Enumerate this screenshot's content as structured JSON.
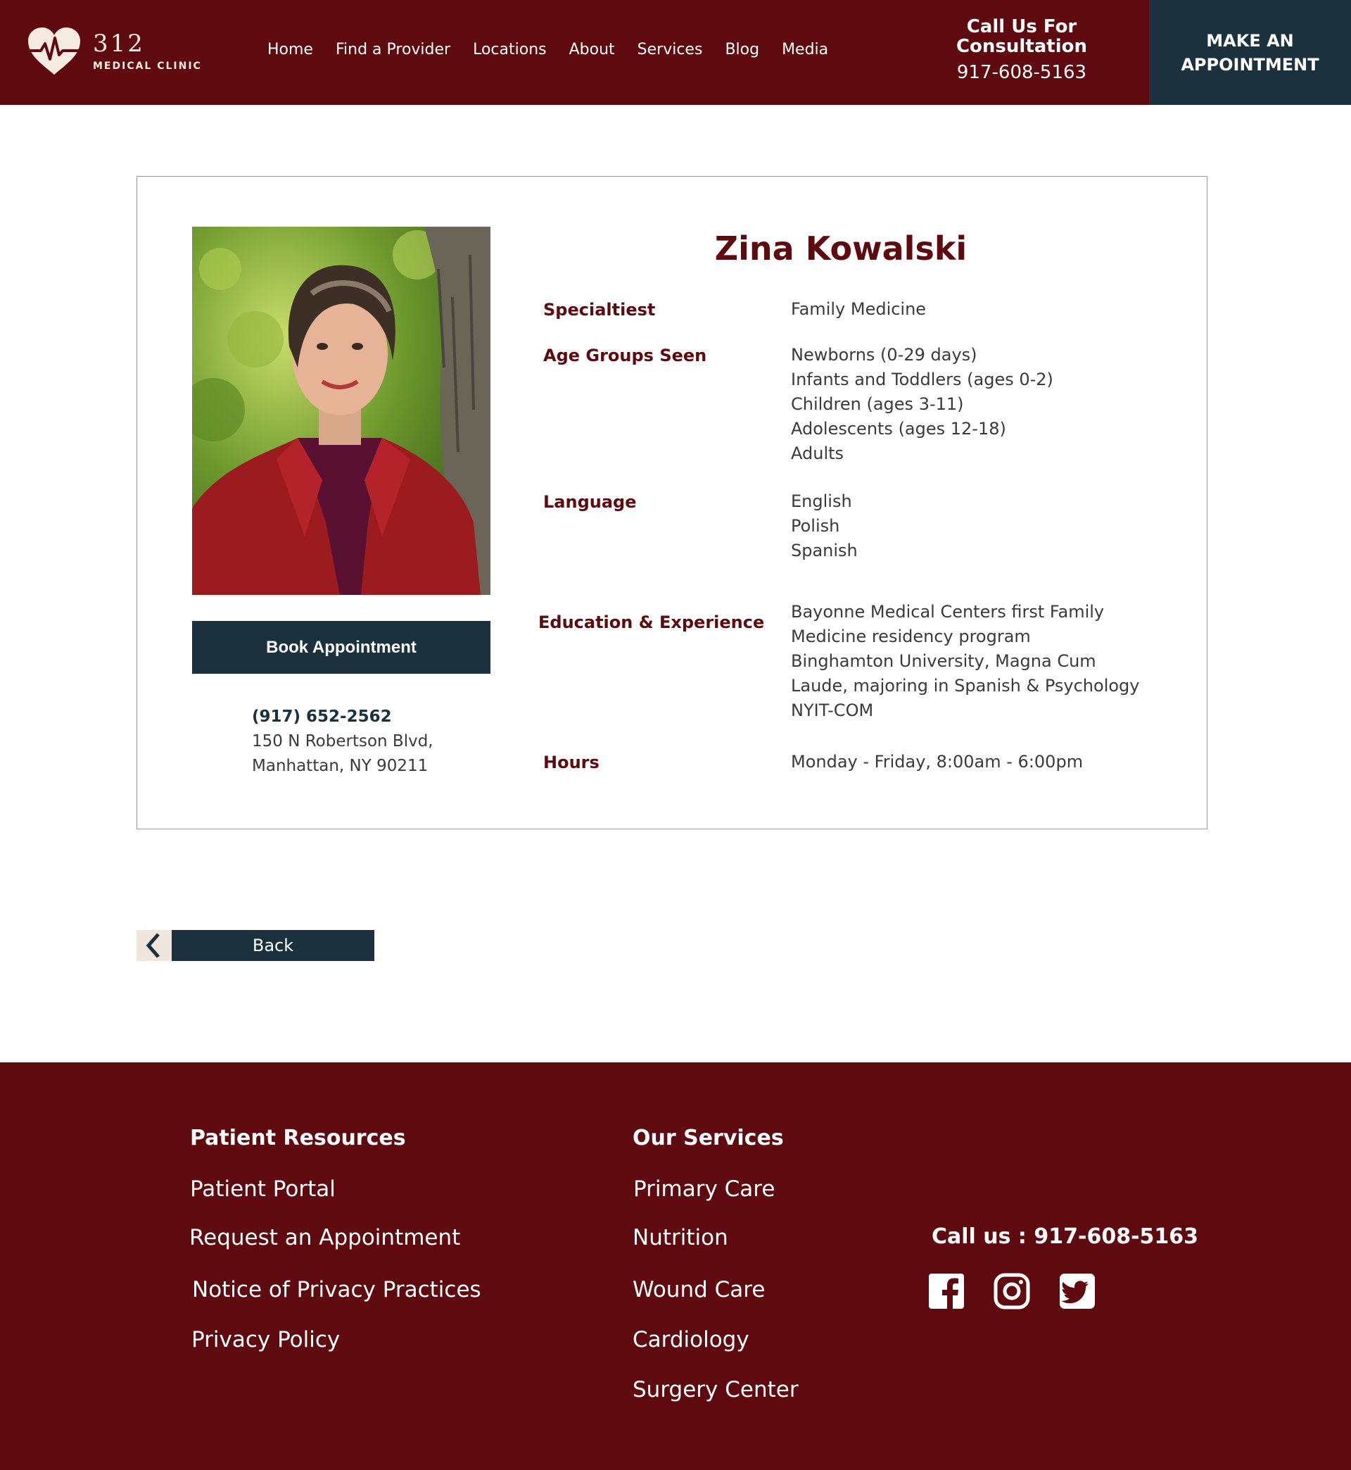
{
  "header": {
    "logo_number": "312",
    "logo_sub": "MEDICAL CLINIC",
    "nav": [
      "Home",
      "Find a Provider",
      "Locations",
      "About",
      "Services",
      "Blog",
      "Media"
    ],
    "call_title_1": "Call Us For",
    "call_title_2": "Consultation",
    "call_phone": "917-608-5163",
    "appointment_1": "MAKE AN",
    "appointment_2": "APPOINTMENT"
  },
  "provider": {
    "name": "Zina Kowalski",
    "book_label": "Book Appointment",
    "phone": "(917) 652-2562",
    "address_1": "150 N Robertson Blvd,",
    "address_2": "Manhattan, NY 90211",
    "labels": {
      "specialty": "Specialtiest",
      "age_groups": "Age Groups Seen",
      "language": "Language",
      "education": "Education & Experience",
      "hours": "Hours"
    },
    "specialty": "Family Medicine",
    "age_groups": [
      "Newborns (0-29 days)",
      "Infants and Toddlers (ages 0-2)",
      "Children (ages 3-11)",
      "Adolescents (ages 12-18)",
      "Adults"
    ],
    "languages": [
      "English",
      "Polish",
      "Spanish"
    ],
    "education": [
      "Bayonne Medical Centers first Family",
      "Medicine residency program",
      "Binghamton University, Magna Cum",
      "Laude, majoring in Spanish & Psychology",
      "NYIT-COM"
    ],
    "hours": "Monday - Friday,  8:00am - 6:00pm"
  },
  "back_label": "Back",
  "footer": {
    "patient_resources_title": "Patient Resources",
    "patient_resources": [
      "Patient Portal",
      "Request an Appointment",
      "Notice of Privacy Practices",
      "Privacy Policy"
    ],
    "services_title": "Our Services",
    "services": [
      "Primary Care",
      "Nutrition",
      "Wound Care",
      "Cardiology",
      "Surgery Center"
    ],
    "call": "Call us : 917-608-5163"
  },
  "colors": {
    "brand": "#5e0a0f",
    "navy": "#1b323e",
    "cream": "#efe6dc"
  },
  "icons": [
    "heart-pulse-logo-icon",
    "chevron-left-icon",
    "facebook-icon",
    "instagram-icon",
    "twitter-icon"
  ]
}
